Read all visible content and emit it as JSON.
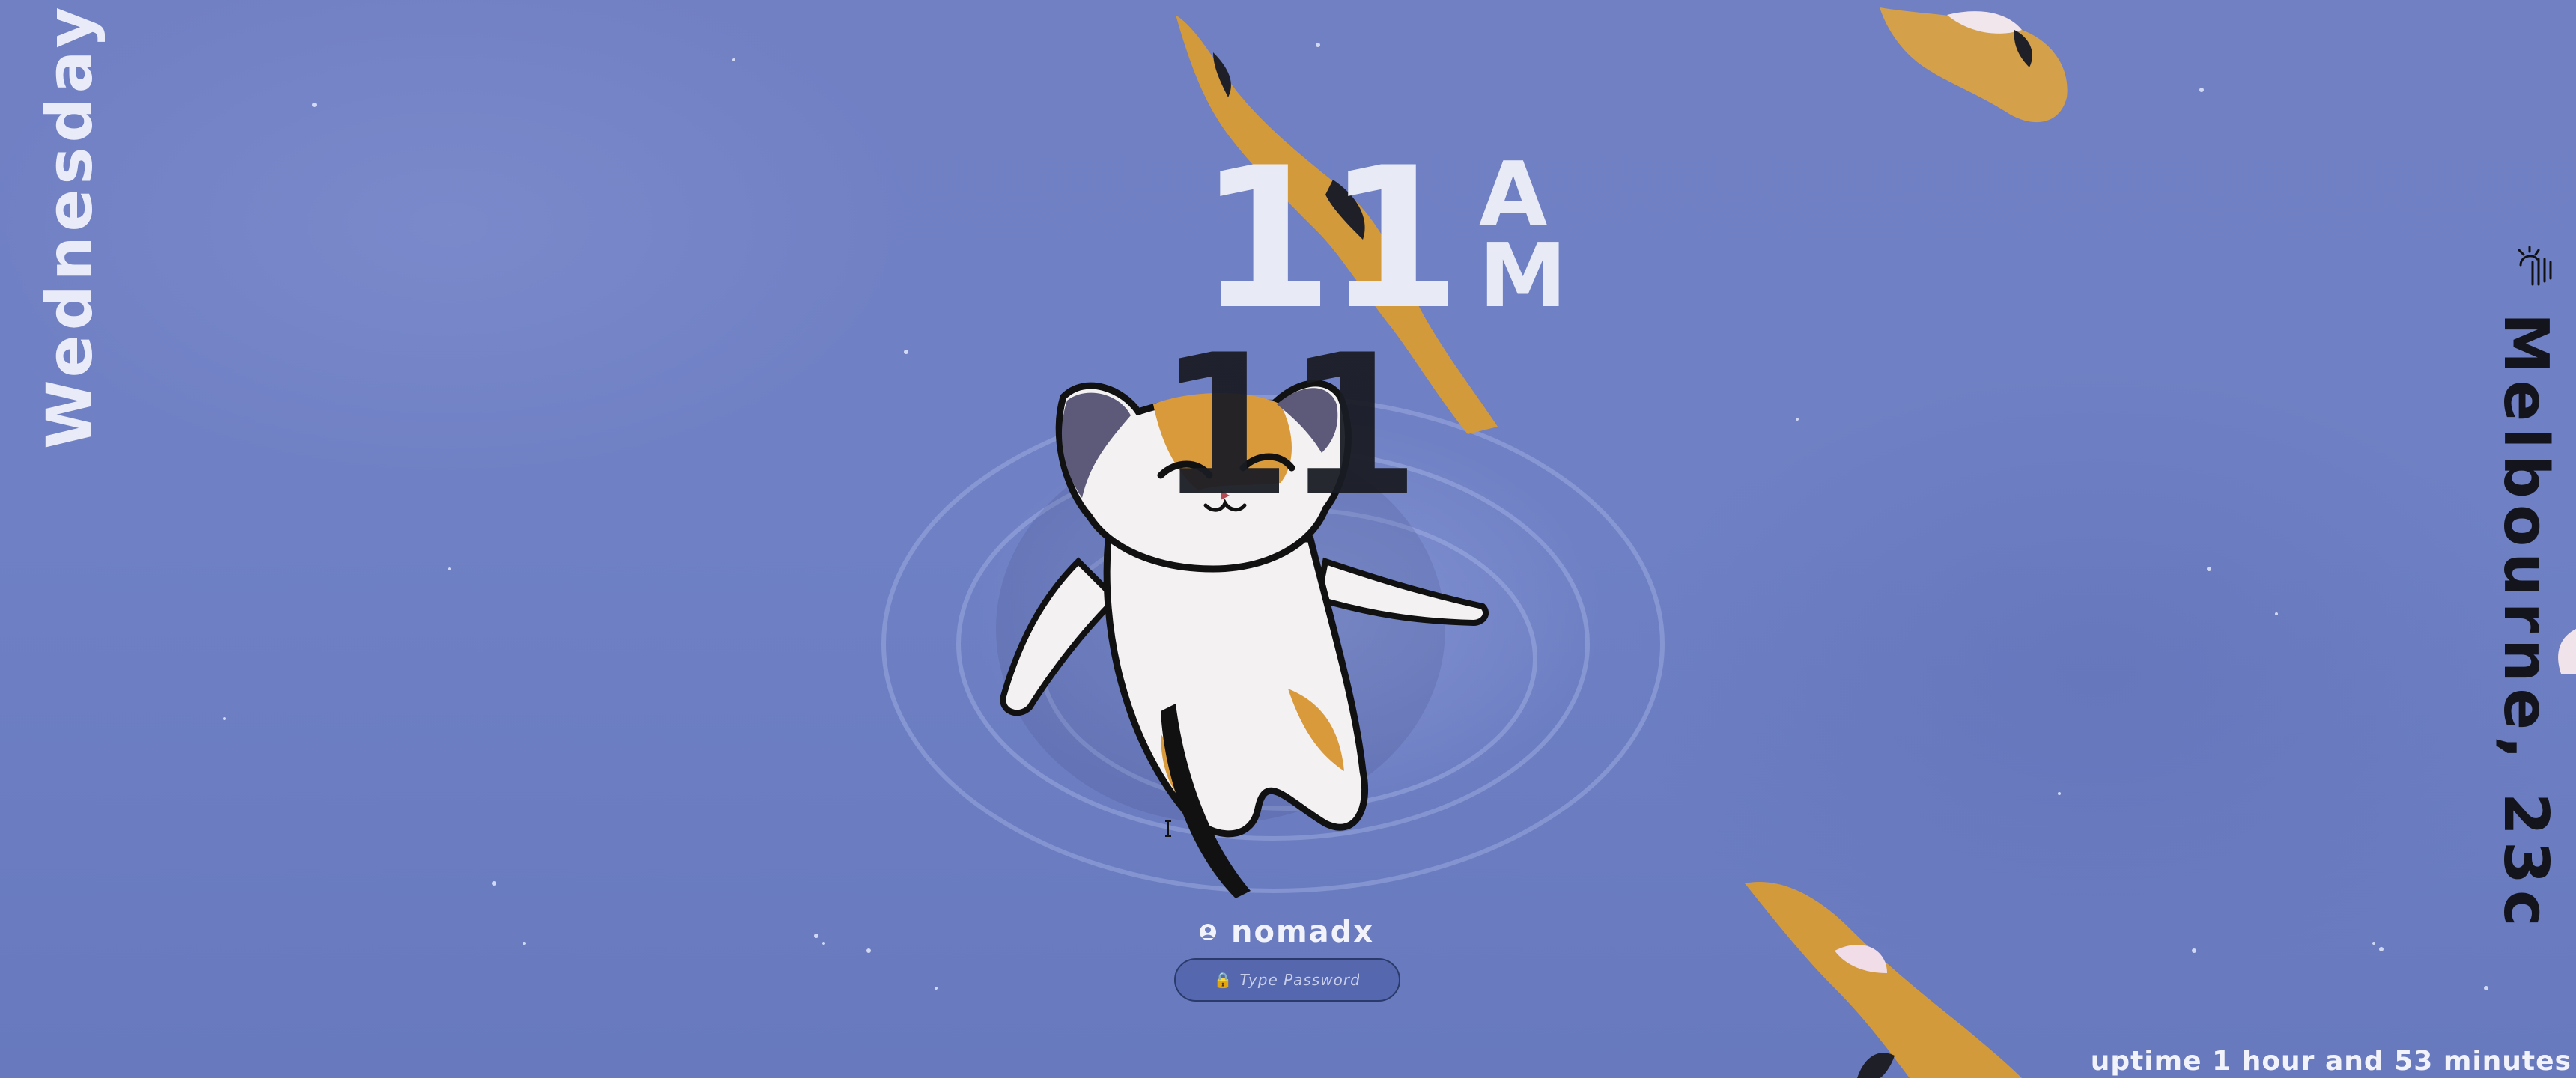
{
  "lockscreen": {
    "day": "Wednesday",
    "clock": {
      "hour": "11",
      "ampm": "AM",
      "minute": "11"
    },
    "weather": {
      "location_temp": "Melbourne, 23c",
      "icon": "weather-icon"
    },
    "user": {
      "name": "nomadx",
      "icon": "user-icon"
    },
    "password": {
      "placeholder": "Type Password",
      "value": "",
      "icon": "lock-icon"
    },
    "uptime": "uptime 1 hour and 53 minutes"
  },
  "colors": {
    "background": "#6e7fc2",
    "text_light": "#e8ebf6",
    "text_dark": "#1a1c24",
    "input_border": "#2a3a6a",
    "koi_orange": "#d79a3a"
  }
}
